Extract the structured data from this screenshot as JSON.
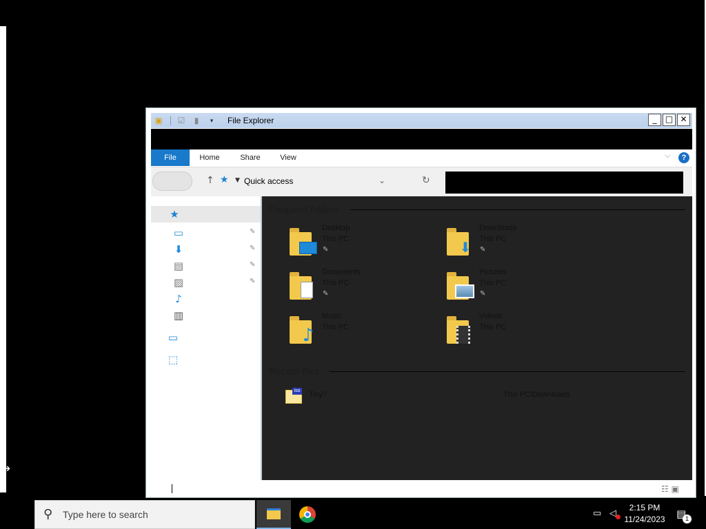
{
  "window": {
    "title": "File Explorer",
    "tabs": [
      "File",
      "Home",
      "Share",
      "View"
    ],
    "address": "Quick access",
    "help_label": "?"
  },
  "sidebar": {
    "items": [
      {
        "icon": "quick-access-pin-icon",
        "pinned": false
      },
      {
        "icon": "desktop-icon",
        "pinned": true
      },
      {
        "icon": "downloads-icon",
        "pinned": true
      },
      {
        "icon": "documents-icon",
        "pinned": true
      },
      {
        "icon": "pictures-icon",
        "pinned": true
      },
      {
        "icon": "music-icon",
        "pinned": false
      },
      {
        "icon": "videos-icon",
        "pinned": false
      },
      {
        "icon": "this-pc-icon",
        "pinned": false
      },
      {
        "icon": "network-icon",
        "pinned": false
      }
    ]
  },
  "main": {
    "frequent_header": "Frequent folders",
    "folders": [
      {
        "name": "Desktop",
        "location": "This PC",
        "icon": "desktop-folder-icon"
      },
      {
        "name": "Downloads",
        "location": "This PC",
        "icon": "downloads-folder-icon"
      },
      {
        "name": "Documents",
        "location": "This PC",
        "icon": "documents-folder-icon"
      },
      {
        "name": "Pictures",
        "location": "This PC",
        "icon": "pictures-folder-icon"
      },
      {
        "name": "Music",
        "location": "This PC",
        "icon": "music-folder-icon"
      },
      {
        "name": "Videos",
        "location": "This PC",
        "icon": "videos-folder-icon"
      }
    ],
    "recent_header": "Recent files",
    "recent": [
      {
        "name": "Tiny7",
        "path": "This PC\\Downloads",
        "badge": "iso"
      }
    ]
  },
  "taskbar": {
    "search_placeholder": "Type here to search",
    "time": "2:15 PM",
    "date": "11/24/2023",
    "notification_count": "1"
  },
  "colors": {
    "accent": "#1979ca",
    "content_bg": "#222222",
    "folder": "#f2c94c"
  }
}
